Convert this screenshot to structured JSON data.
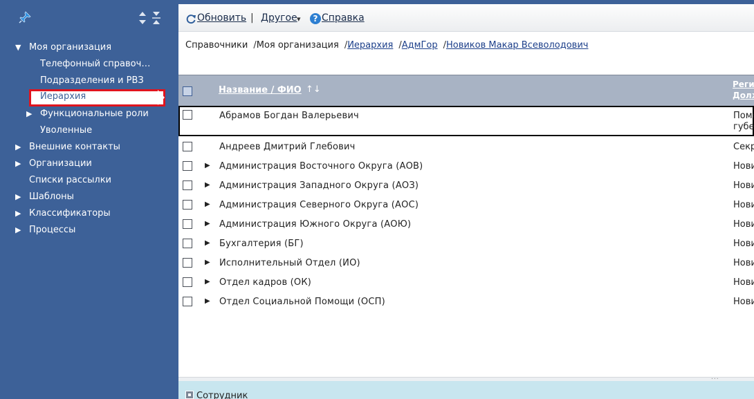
{
  "colors": {
    "sidebar_bg": "#3d6198",
    "selection_border": "#e0141e",
    "grid_header_bg": "#a8b3c4",
    "bottom_panel_bg": "#c8e6ef",
    "link": "#1c3f8a"
  },
  "sidebar": {
    "icons": {
      "pin": "pin-icon",
      "expand_all": "expand-all-icon",
      "collapse_all": "collapse-all-icon"
    },
    "items": [
      {
        "label": "Моя организация",
        "arrow": "▼"
      },
      {
        "label": "Телефонный справоч…",
        "arrow": ""
      },
      {
        "label": "Подразделения и РВЗ",
        "arrow": ""
      },
      {
        "label": "Иерархия",
        "arrow": "",
        "selected": true
      },
      {
        "label": "Функциональные роли",
        "arrow": "▶"
      },
      {
        "label": "Уволенные",
        "arrow": ""
      },
      {
        "label": "Внешние контакты",
        "arrow": "▶"
      },
      {
        "label": "Организации",
        "arrow": "▶"
      },
      {
        "label": "Списки рассылки",
        "arrow": ""
      },
      {
        "label": "Шаблоны",
        "arrow": "▶"
      },
      {
        "label": "Классификаторы",
        "arrow": "▶"
      },
      {
        "label": "Процессы",
        "arrow": "▶"
      }
    ]
  },
  "toolbar": {
    "refresh_label": "Обновить",
    "separator": "|",
    "other_label": "Другое",
    "other_caret": "▾",
    "help_label": "Справка",
    "help_glyph": "?"
  },
  "breadcrumb": {
    "items": [
      "Справочники",
      "Моя организация",
      "Иерархия",
      "АдмГор",
      "Новиков Макар Всеволодович"
    ],
    "separator": "/"
  },
  "grid": {
    "columns": {
      "name": "Название / ФИО",
      "sort_glyph": "↑↓",
      "region_line1": "Реги",
      "region_line2": "Долж"
    },
    "rows": [
      {
        "name": "Абрамов Богдан Валерьевич",
        "region": "Помо",
        "region2": "губе",
        "expandable": false
      },
      {
        "name": "Андреев Дмитрий Глебович",
        "region": "Секр",
        "expandable": false
      },
      {
        "name": "Администрация Восточного Округа (АОВ)",
        "region": "Нови",
        "expandable": true
      },
      {
        "name": "Администрация Западного Округа (АОЗ)",
        "region": "Нови",
        "expandable": true
      },
      {
        "name": "Администрация Северного Округа (АОС)",
        "region": "Нови",
        "expandable": true
      },
      {
        "name": "Администрация Южного Округа (АОЮ)",
        "region": "Нови",
        "expandable": true
      },
      {
        "name": "Бухгалтерия (БГ)",
        "region": "Нови",
        "expandable": true
      },
      {
        "name": "Исполнительный Отдел (ИО)",
        "region": "Нови",
        "expandable": true
      },
      {
        "name": "Отдел кадров (ОК)",
        "region": "Нови",
        "expandable": true
      },
      {
        "name": "Отдел Социальной Помощи (ОСП)",
        "region": "Нови",
        "expandable": true
      }
    ],
    "expand_glyph": "▶"
  },
  "splitter": {
    "grip": "..."
  },
  "bottom_panel": {
    "label": "Сотрудник"
  }
}
